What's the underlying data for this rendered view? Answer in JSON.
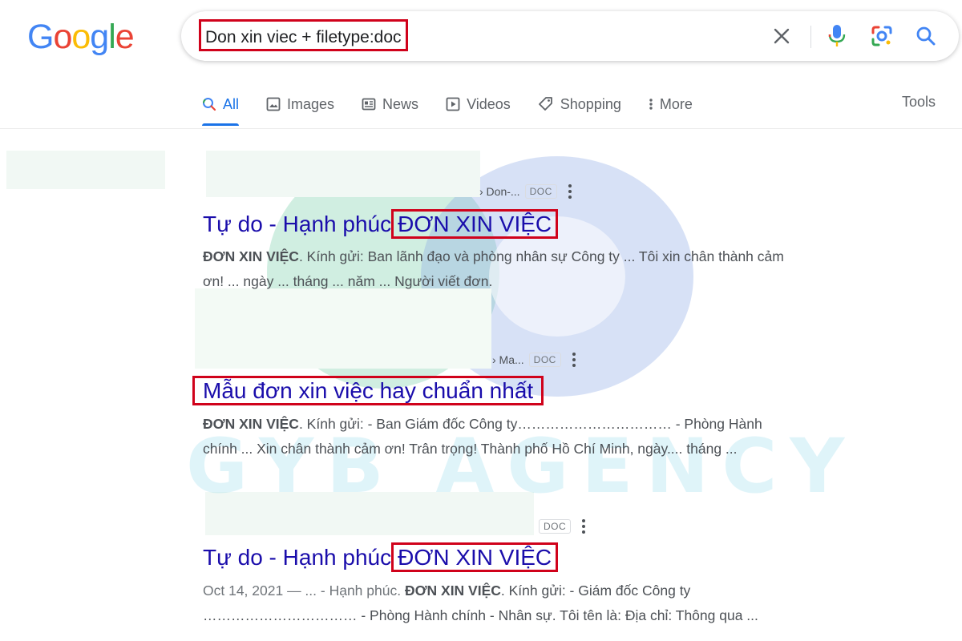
{
  "logo": {
    "text": "Google",
    "letters": [
      {
        "ch": "G",
        "color": "#4285f4"
      },
      {
        "ch": "o",
        "color": "#ea4335"
      },
      {
        "ch": "o",
        "color": "#fbbc05"
      },
      {
        "ch": "g",
        "color": "#4285f4"
      },
      {
        "ch": "l",
        "color": "#34a853"
      },
      {
        "ch": "e",
        "color": "#ea4335"
      }
    ]
  },
  "search": {
    "query": "Don xin viec + filetype:doc",
    "icons": [
      "clear-icon",
      "microphone-icon",
      "lens-icon",
      "search-icon"
    ]
  },
  "tabs": [
    {
      "label": "All",
      "icon": "search-icon",
      "active": true
    },
    {
      "label": "Images",
      "icon": "image-icon",
      "active": false
    },
    {
      "label": "News",
      "icon": "news-icon",
      "active": false
    },
    {
      "label": "Videos",
      "icon": "video-icon",
      "active": false
    },
    {
      "label": "Shopping",
      "icon": "tag-icon",
      "active": false
    },
    {
      "label": "More",
      "icon": "more-vert-icon",
      "active": false
    }
  ],
  "tools_label": "Tools",
  "watermark": "GYB AGENCY",
  "results": [
    {
      "cite": "› Don-...",
      "badge": "DOC",
      "title_prefix": "Tự do - Hạnh phúc",
      "title_highlight": "ĐƠN XIN VIỆC",
      "snippet_bold": "ĐƠN XIN VIỆC",
      "snippet_line1": ". Kính gửi: Ban lãnh đạo và phòng nhân sự Công ty ... Tôi xin chân thành cảm",
      "snippet_line2": "ơn! ... ngày ... tháng ... năm ... Người viết đơn."
    },
    {
      "cite": "› Ma...",
      "badge": "DOC",
      "title_prefix": "",
      "title_highlight": "Mẫu đơn xin việc hay chuẩn nhất",
      "snippet_bold": "ĐƠN XIN VIỆC",
      "snippet_line1": ". Kính gửi: - Ban Giám đốc Công ty…………………………… - Phòng Hành",
      "snippet_line2": "chính ... Xin chân thành cảm ơn! Trân trọng! Thành phố Hồ Chí Minh, ngày.... tháng ..."
    },
    {
      "cite": "",
      "badge": "DOC",
      "title_prefix": "Tự do - Hạnh phúc",
      "title_highlight": "ĐƠN XIN VIỆC",
      "snippet_date": "Oct 14, 2021 — ... - Hạnh phúc. ",
      "snippet_bold": "ĐƠN XIN VIỆC",
      "snippet_line1": ". Kính gửi: - Giám đốc Công ty",
      "snippet_line2": "…………………………… - Phòng Hành chính - Nhân sự. Tôi tên là: Địa chỉ: Thông qua ..."
    }
  ]
}
